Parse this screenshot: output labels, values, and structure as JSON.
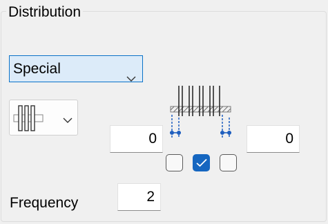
{
  "group": {
    "title": "Distribution"
  },
  "distribution_select": {
    "value": "Special",
    "icon": "chevron-down-icon"
  },
  "layout_dropdown": {
    "icon": "distribution-layout-icon",
    "arrow": "chevron-down-icon"
  },
  "offsets": {
    "left_value": "0",
    "right_value": "0"
  },
  "checkboxes": [
    {
      "name": "left",
      "checked": false
    },
    {
      "name": "middle",
      "checked": true
    },
    {
      "name": "right",
      "checked": false
    }
  ],
  "frequency": {
    "label": "Frequency",
    "value": "2"
  },
  "colors": {
    "accent": "#0a72c8",
    "checked": "#1566c0",
    "dimension": "#1f5fbf"
  }
}
